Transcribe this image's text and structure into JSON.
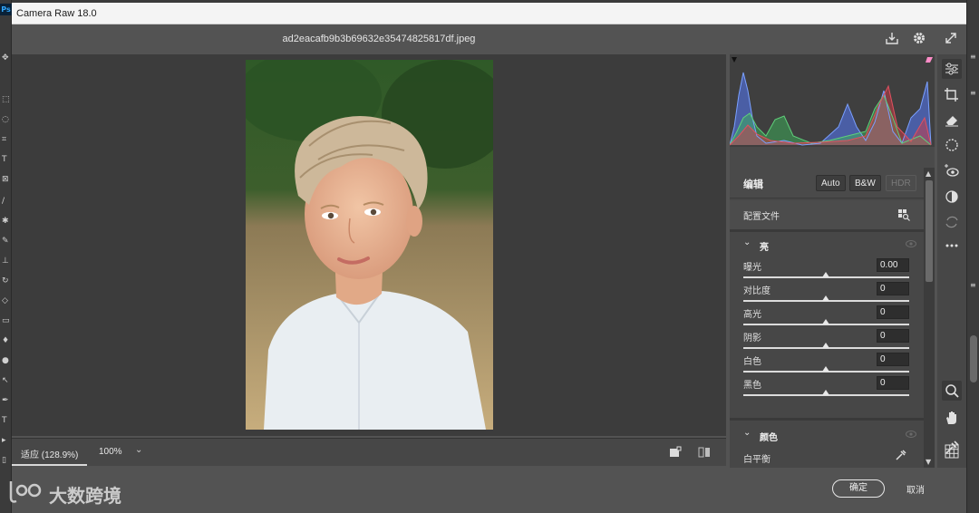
{
  "app": {
    "title": "Camera Raw 18.0",
    "ps_logo": "Ps"
  },
  "header": {
    "filename": "ad2eacafb9b3b69632e35474825817df.jpeg"
  },
  "bottom_bar": {
    "zoom_mode": "适应 (128.9%)",
    "zoom_value": "100%"
  },
  "panel": {
    "edit_label": "编辑",
    "auto_label": "Auto",
    "bw_label": "B&W",
    "hdr_label": "HDR",
    "profile_label": "配置文件",
    "light_section": "亮",
    "color_section": "颜色",
    "white_balance_label": "白平衡",
    "sliders": [
      {
        "label": "曝光",
        "value": "0.00"
      },
      {
        "label": "对比度",
        "value": "0"
      },
      {
        "label": "高光",
        "value": "0"
      },
      {
        "label": "阴影",
        "value": "0"
      },
      {
        "label": "白色",
        "value": "0"
      },
      {
        "label": "黑色",
        "value": "0"
      }
    ]
  },
  "footer": {
    "ok_label": "确定",
    "cancel_label": "取消"
  },
  "watermark": {
    "text": "大数跨境"
  },
  "colors": {
    "accent": "#31a8ff",
    "panel_bg": "#474747",
    "canvas_bg": "#3c3c3c"
  },
  "icons": [
    "save-icon",
    "gear-icon",
    "expand-icon",
    "edit-sliders-icon",
    "crop-icon",
    "eraser-icon",
    "mask-icon",
    "redeye-icon",
    "presets-icon",
    "snapshot-icon",
    "more-icon",
    "zoom-icon",
    "hand-icon",
    "color-sampler-icon",
    "grid-icon",
    "eyedropper-icon",
    "eye-icon"
  ]
}
